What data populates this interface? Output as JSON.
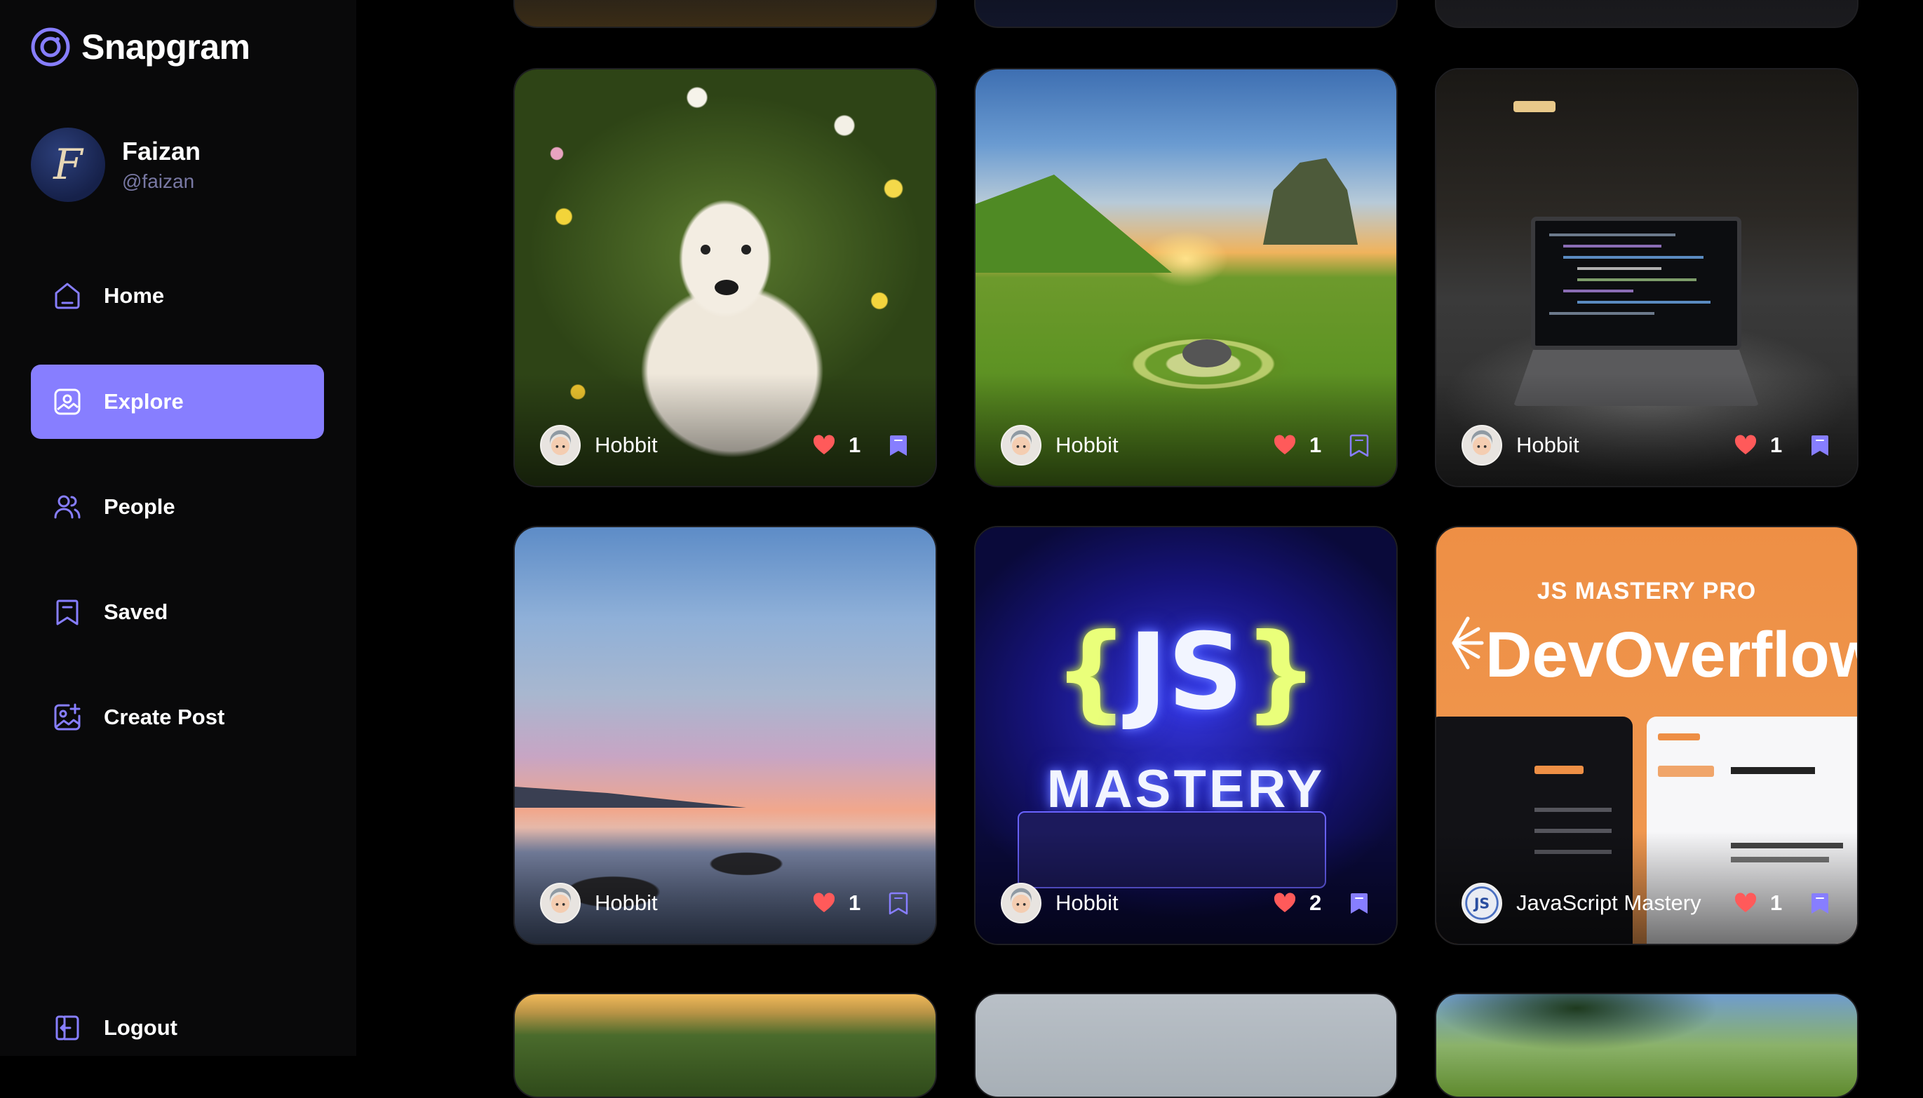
{
  "app": {
    "name": "Snapgram",
    "colors": {
      "accent": "#877eff",
      "background": "#000000",
      "sidebar": "#09090a",
      "like": "#ff5a5a",
      "handle": "#7878a3"
    }
  },
  "user": {
    "name": "Faizan",
    "handle": "@faizan",
    "avatar_letter": "F"
  },
  "nav": [
    {
      "label": "Home",
      "icon": "home-icon",
      "active": false
    },
    {
      "label": "Explore",
      "icon": "explore-icon",
      "active": true
    },
    {
      "label": "People",
      "icon": "people-icon",
      "active": false
    },
    {
      "label": "Saved",
      "icon": "bookmark-icon",
      "active": false
    },
    {
      "label": "Create Post",
      "icon": "create-post-icon",
      "active": false
    }
  ],
  "logout": {
    "label": "Logout",
    "icon": "logout-icon"
  },
  "posts": [
    {
      "creator": "Hobbit",
      "likes": "1",
      "saved": true,
      "image": "puppy-in-flowers"
    },
    {
      "creator": "Hobbit",
      "likes": "1",
      "saved": false,
      "image": "green-valley-sunset"
    },
    {
      "creator": "Hobbit",
      "likes": "1",
      "saved": true,
      "image": "laptop-code"
    },
    {
      "creator": "Hobbit",
      "likes": "1",
      "saved": false,
      "image": "beach-sunset"
    },
    {
      "creator": "Hobbit",
      "likes": "2",
      "saved": true,
      "image": "js-mastery-neon"
    },
    {
      "creator": "JavaScript Mastery",
      "likes": "1",
      "saved": true,
      "image": "devoverflow-promo"
    }
  ],
  "promo": {
    "subtitle": "JS MASTERY PRO",
    "title": "DevOverflow"
  },
  "neon": {
    "brand": "JS",
    "word": "MASTERY"
  }
}
